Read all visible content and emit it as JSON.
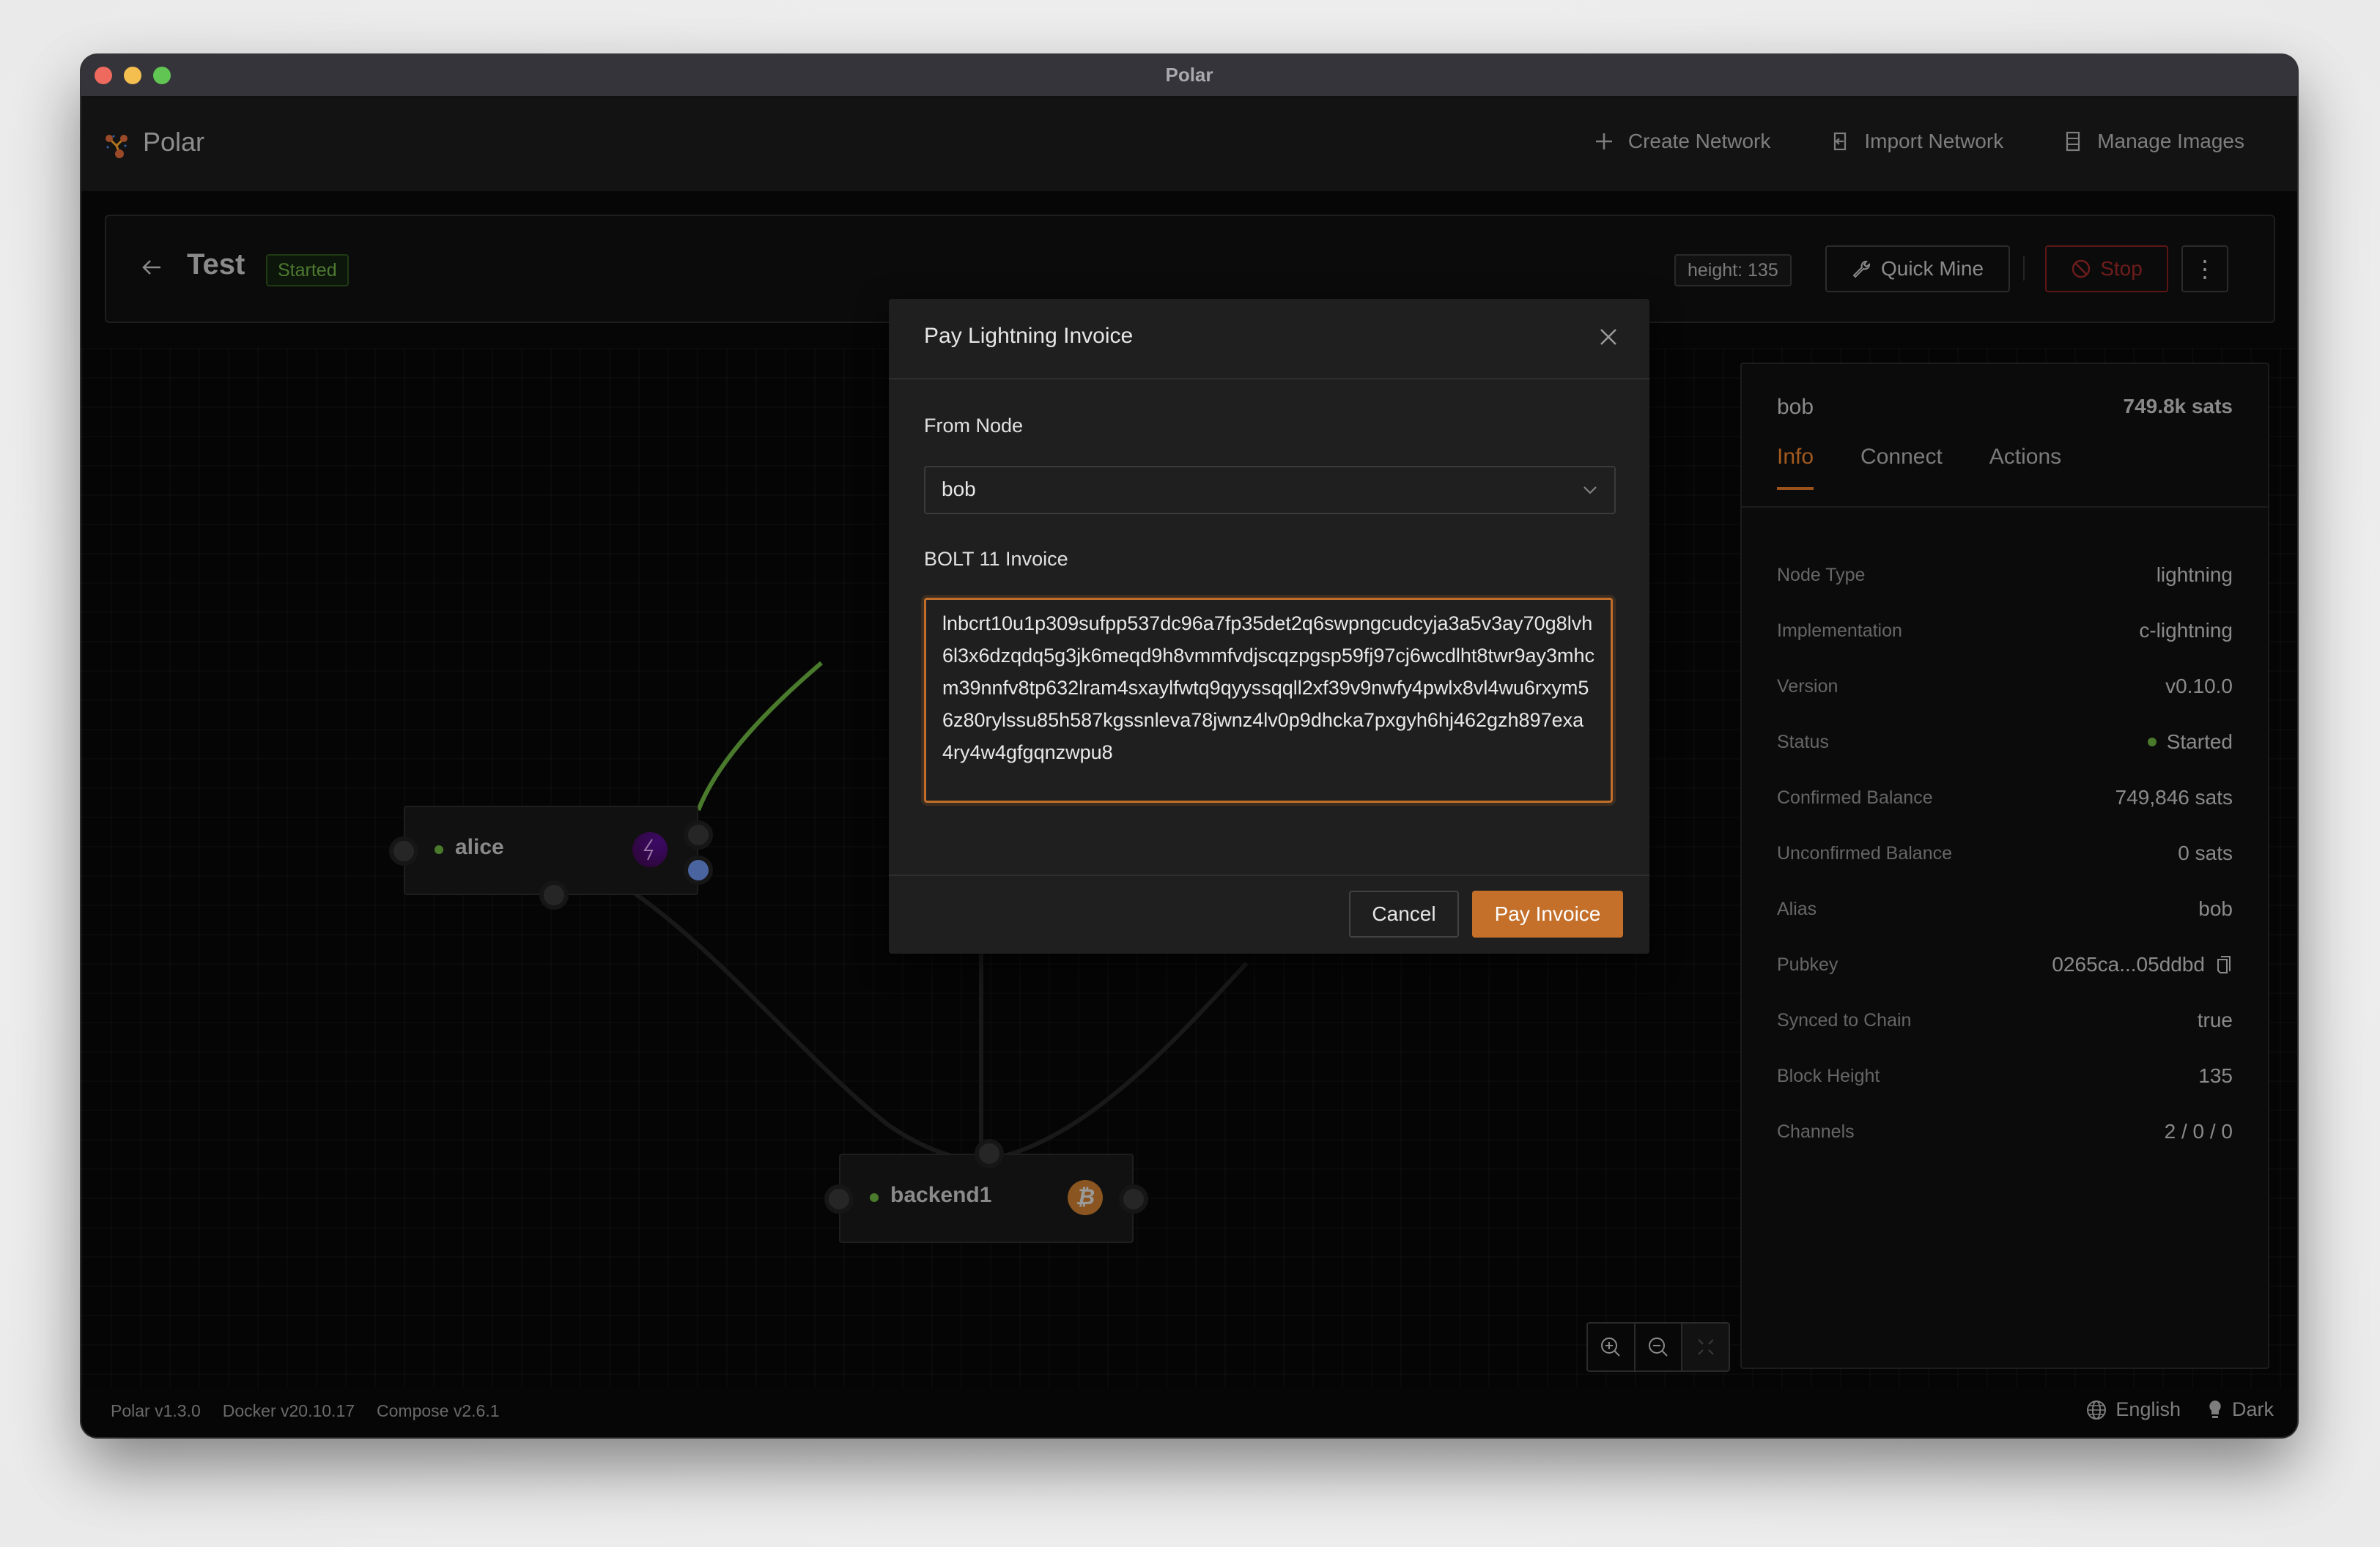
{
  "window": {
    "title": "Polar"
  },
  "header": {
    "brand": "Polar",
    "nav": [
      {
        "label": "Create Network",
        "icon": "plus-icon"
      },
      {
        "label": "Import Network",
        "icon": "import-icon"
      },
      {
        "label": "Manage Images",
        "icon": "database-icon"
      }
    ]
  },
  "network": {
    "name": "Test",
    "status": "Started",
    "height_tag": "height: 135",
    "quick_mine": "Quick Mine",
    "stop": "Stop",
    "more": "⋮"
  },
  "canvas": {
    "nodes": [
      {
        "name": "alice",
        "type": "lightning",
        "status": "started"
      },
      {
        "name": "backend1",
        "type": "bitcoin",
        "status": "started"
      }
    ]
  },
  "sidepanel": {
    "node_name": "bob",
    "balance": "749.8k sats",
    "tabs": [
      {
        "label": "Info",
        "active": true
      },
      {
        "label": "Connect",
        "active": false
      },
      {
        "label": "Actions",
        "active": false
      }
    ],
    "rows": [
      {
        "key": "Node Type",
        "value": "lightning"
      },
      {
        "key": "Implementation",
        "value": "c-lightning"
      },
      {
        "key": "Version",
        "value": "v0.10.0"
      },
      {
        "key": "Status",
        "value": "Started"
      },
      {
        "key": "Confirmed Balance",
        "value": "749,846 sats"
      },
      {
        "key": "Unconfirmed Balance",
        "value": "0 sats"
      },
      {
        "key": "Alias",
        "value": "bob"
      },
      {
        "key": "Pubkey",
        "value": "0265ca...05ddbd"
      },
      {
        "key": "Synced to Chain",
        "value": "true"
      },
      {
        "key": "Block Height",
        "value": "135"
      },
      {
        "key": "Channels",
        "value": "2 / 0 / 0"
      }
    ]
  },
  "footer": {
    "versions": [
      "Polar v1.3.0",
      "Docker v20.10.17",
      "Compose v2.6.1"
    ],
    "language": "English",
    "theme": "Dark"
  },
  "modal": {
    "title": "Pay Lightning Invoice",
    "from_node_label": "From Node",
    "from_node_value": "bob",
    "invoice_label": "BOLT 11 Invoice",
    "invoice_value": "lnbcrt10u1p309sufpp537dc96a7fp35det2q6swpngcudcyja3a5v3ay70g8lvh6l3x6dzqdq5g3jk6meqd9h8vmmfvdjscqzpgsp59fj97cj6wcdlht8twr9ay3mhcm39nnfv8tp632lram4sxaylfwtq9qyyssqqll2xf39v9nwfy4pwlx8vl4wu6rxym56z80rylssu85h587kgssnleva78jwnz4lv0p9dhcka7pxgyh6hj462gzh897exa4ry4w4gfgqnzwpu8",
    "cancel": "Cancel",
    "pay": "Pay Invoice"
  },
  "colors": {
    "accent": "#c4702b",
    "success": "#4a7a2c",
    "danger": "#6e1c1c",
    "lightning_badge": "#3a0a5a",
    "bitcoin_badge": "#8a5520"
  }
}
